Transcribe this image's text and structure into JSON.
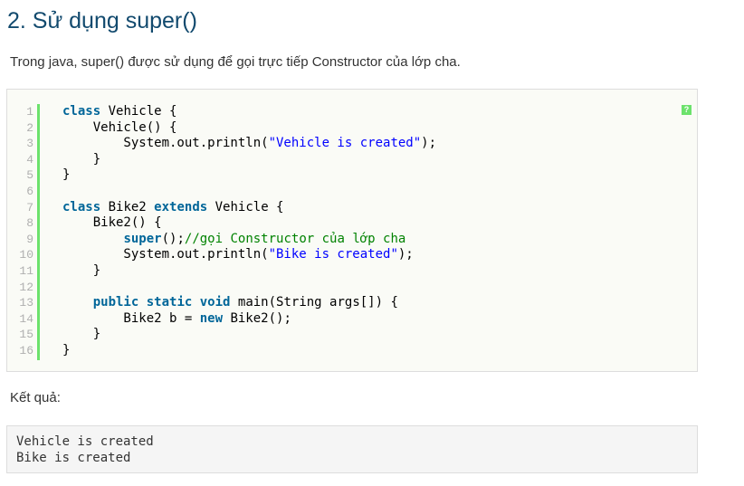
{
  "heading": "2. Sử dụng super()",
  "intro": "Trong java, super() được sử dụng để gọi trực tiếp Constructor của lớp cha.",
  "code_block": {
    "help_icon_label": "?",
    "line_numbers": [
      "1",
      "2",
      "3",
      "4",
      "5",
      "6",
      "7",
      "8",
      "9",
      "10",
      "11",
      "12",
      "13",
      "14",
      "15",
      "16"
    ],
    "lines": [
      [
        {
          "t": "class",
          "c": "kw"
        },
        {
          "t": " Vehicle {",
          "c": ""
        }
      ],
      [
        {
          "t": "    Vehicle() {",
          "c": ""
        }
      ],
      [
        {
          "t": "        System.out.println(",
          "c": ""
        },
        {
          "t": "\"Vehicle is created\"",
          "c": "str"
        },
        {
          "t": ");",
          "c": ""
        }
      ],
      [
        {
          "t": "    }",
          "c": ""
        }
      ],
      [
        {
          "t": "}",
          "c": ""
        }
      ],
      [
        {
          "t": "",
          "c": ""
        }
      ],
      [
        {
          "t": "class",
          "c": "kw"
        },
        {
          "t": " Bike2 ",
          "c": ""
        },
        {
          "t": "extends",
          "c": "kw"
        },
        {
          "t": " Vehicle {",
          "c": ""
        }
      ],
      [
        {
          "t": "    Bike2() {",
          "c": ""
        }
      ],
      [
        {
          "t": "        ",
          "c": ""
        },
        {
          "t": "super",
          "c": "kw"
        },
        {
          "t": "();",
          "c": ""
        },
        {
          "t": "//gọi Constructor của lớp cha",
          "c": "cmt"
        }
      ],
      [
        {
          "t": "        System.out.println(",
          "c": ""
        },
        {
          "t": "\"Bike is created\"",
          "c": "str"
        },
        {
          "t": ");",
          "c": ""
        }
      ],
      [
        {
          "t": "    }",
          "c": ""
        }
      ],
      [
        {
          "t": "",
          "c": ""
        }
      ],
      [
        {
          "t": "    ",
          "c": ""
        },
        {
          "t": "public",
          "c": "kw"
        },
        {
          "t": " ",
          "c": ""
        },
        {
          "t": "static",
          "c": "kw"
        },
        {
          "t": " ",
          "c": ""
        },
        {
          "t": "void",
          "c": "kw"
        },
        {
          "t": " main(String args[]) {",
          "c": ""
        }
      ],
      [
        {
          "t": "        Bike2 b = ",
          "c": ""
        },
        {
          "t": "new",
          "c": "kw"
        },
        {
          "t": " Bike2();",
          "c": ""
        }
      ],
      [
        {
          "t": "    }",
          "c": ""
        }
      ],
      [
        {
          "t": "}",
          "c": ""
        }
      ]
    ]
  },
  "result_label": "Kết quả:",
  "output_lines": [
    "Vehicle is created",
    "Bike is created"
  ],
  "colors": {
    "heading": "#124a6e",
    "keyword": "#006699",
    "string": "#0000ff",
    "comment": "#008200",
    "gutter_bar": "#6ce26c",
    "line_number": "#afafaf"
  }
}
